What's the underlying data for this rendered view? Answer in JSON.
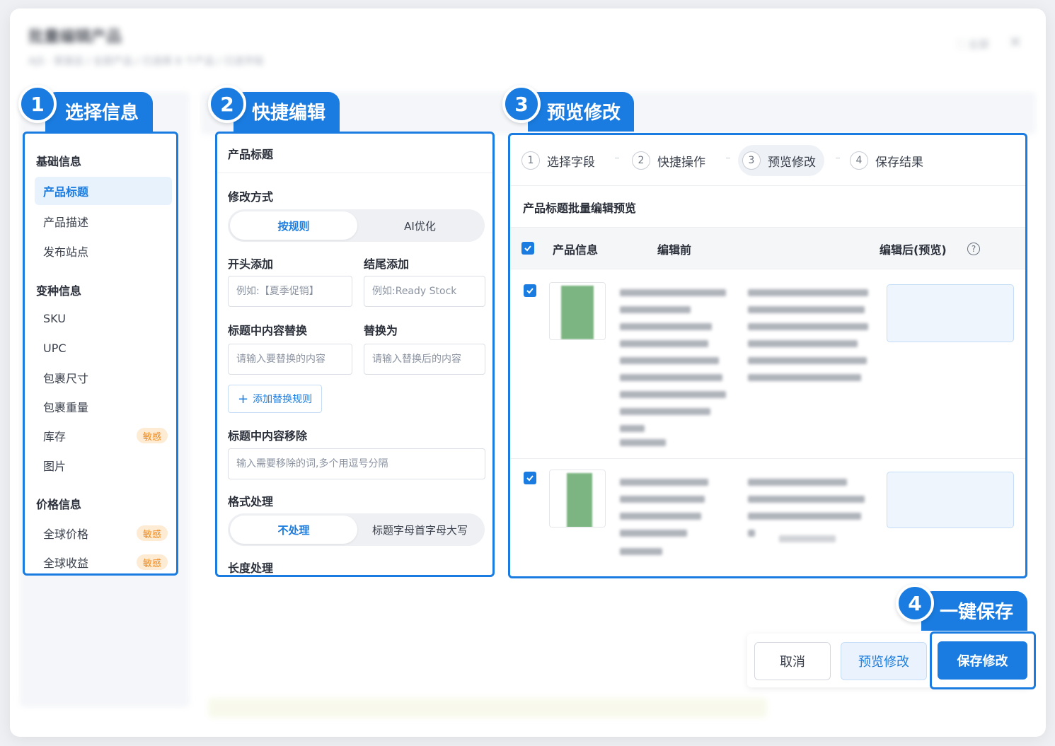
{
  "background": {
    "title": "批量编辑产品",
    "breadcrumb": "AJS · 家居店 / 全部产品 / 已选择 8 个产品 / 已选字段",
    "fullscreen_label": "全屏"
  },
  "callouts": [
    {
      "number": "1",
      "label": "选择信息"
    },
    {
      "number": "2",
      "label": "快捷编辑"
    },
    {
      "number": "3",
      "label": "预览修改"
    },
    {
      "number": "4",
      "label": "一键保存"
    }
  ],
  "panel1": {
    "sections": [
      {
        "title": "基础信息",
        "items": [
          {
            "label": "产品标题",
            "active": true
          },
          {
            "label": "产品描述"
          },
          {
            "label": "发布站点"
          }
        ]
      },
      {
        "title": "变种信息",
        "items": [
          {
            "label": "SKU"
          },
          {
            "label": "UPC"
          },
          {
            "label": "包裹尺寸"
          },
          {
            "label": "包裹重量"
          },
          {
            "label": "库存",
            "badge": "敏感"
          },
          {
            "label": "图片"
          }
        ]
      },
      {
        "title": "价格信息",
        "items": [
          {
            "label": "全球价格",
            "badge": "敏感"
          },
          {
            "label": "全球收益",
            "badge": "敏感"
          }
        ]
      }
    ]
  },
  "panel2": {
    "header": "产品标题",
    "modify_method_label": "修改方式",
    "modify_options": [
      "按规则",
      "AI优化"
    ],
    "prefix_label": "开头添加",
    "prefix_placeholder": "例如:【夏季促销】",
    "suffix_label": "结尾添加",
    "suffix_placeholder": "例如:Ready Stock",
    "replace_label": "标题中内容替换",
    "replace_placeholder": "请输入要替换的内容",
    "replace_with_label": "替换为",
    "replace_with_placeholder": "请输入替换后的内容",
    "add_rule_label": "添加替换规则",
    "remove_label": "标题中内容移除",
    "remove_placeholder": "输入需要移除的词,多个用逗号分隔",
    "format_label": "格式处理",
    "format_options": [
      "不处理",
      "标题字母首字母大写"
    ],
    "length_label": "长度处理"
  },
  "panel3": {
    "steps": [
      {
        "num": "1",
        "label": "选择字段"
      },
      {
        "num": "2",
        "label": "快捷操作"
      },
      {
        "num": "3",
        "label": "预览修改"
      },
      {
        "num": "4",
        "label": "保存结果"
      }
    ],
    "step_separator": "-",
    "subtitle": "产品标题批量编辑预览",
    "columns": [
      "产品信息",
      "编辑前",
      "编辑后(预览)"
    ],
    "help_icon": "?"
  },
  "footer": {
    "cancel": "取消",
    "preview": "预览修改",
    "save": "保存修改"
  },
  "colors": {
    "accent": "#1a7ce0",
    "badge_bg": "#fdebd4",
    "badge_text": "#ef8a1f"
  }
}
